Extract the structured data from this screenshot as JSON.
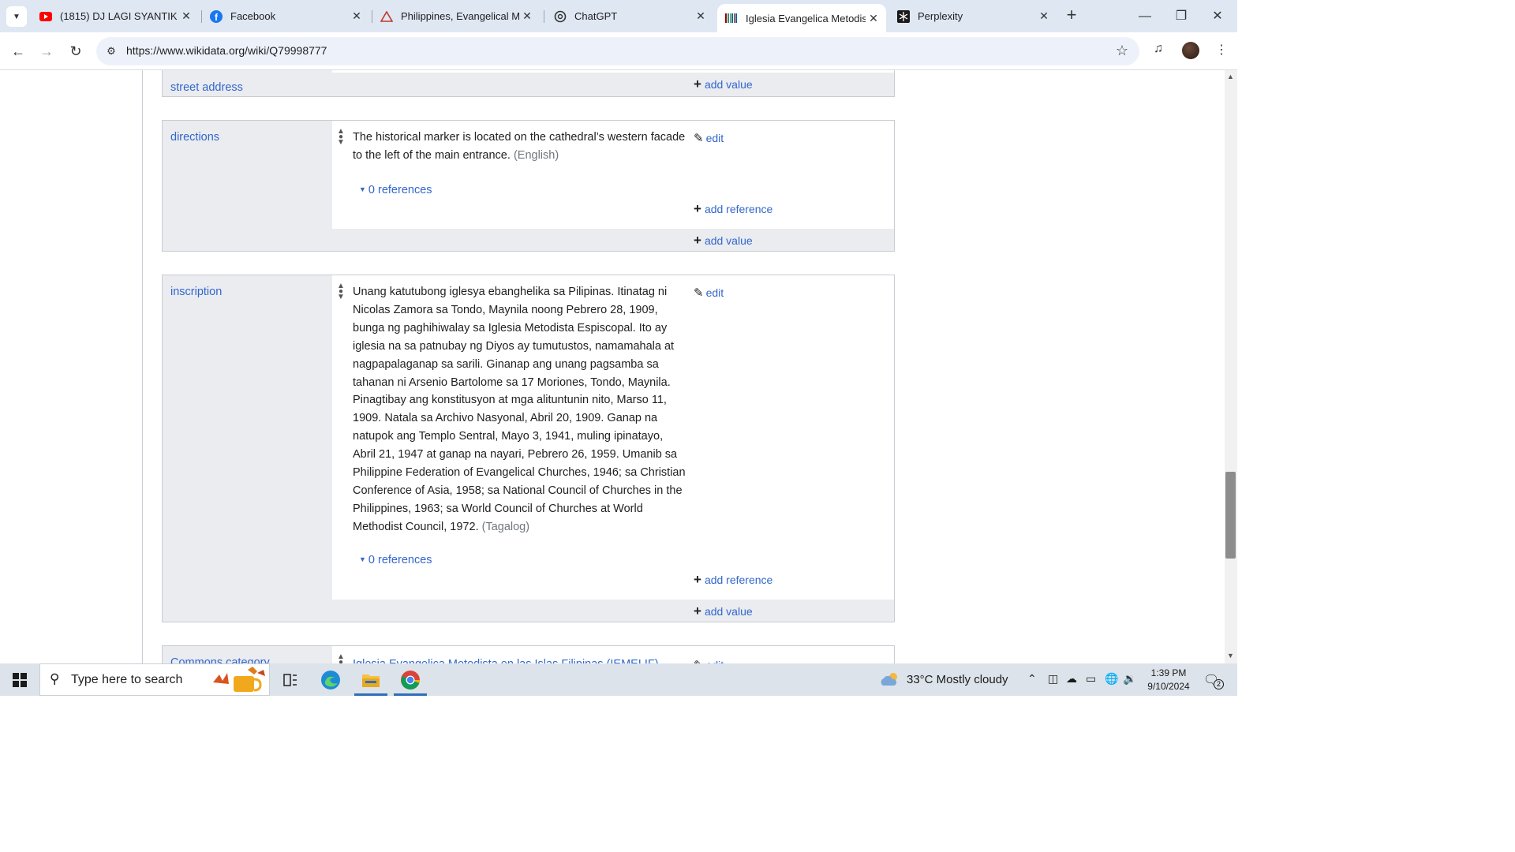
{
  "browser": {
    "tabs": [
      {
        "title": "(1815) DJ LAGI SYANTIK X",
        "icon": "youtube-icon",
        "active": false
      },
      {
        "title": "Facebook",
        "icon": "facebook-icon",
        "active": false
      },
      {
        "title": "Philippines, Evangelical Me",
        "icon": "triangle-icon",
        "active": false
      },
      {
        "title": "ChatGPT",
        "icon": "chatgpt-icon",
        "active": false
      },
      {
        "title": "Iglesia Evangelica Metodist",
        "icon": "wikidata-icon",
        "active": true
      },
      {
        "title": "Perplexity",
        "icon": "perplexity-icon",
        "active": false
      }
    ],
    "url": "https://www.wikidata.org/wiki/Q79998777"
  },
  "statements": {
    "street_address": {
      "label": "street address",
      "add_value": "add value"
    },
    "directions": {
      "label": "directions",
      "text": "The historical marker is located on the cathedral’s western facade to the left of the main entrance.",
      "language": "(English)",
      "edit": "edit",
      "references": "0 references",
      "add_reference": "add reference",
      "add_value": "add value"
    },
    "inscription": {
      "label": "inscription",
      "text": "Unang katutubong iglesya ebanghelika sa Pilipinas. Itinatag ni Nicolas Zamora sa Tondo, Maynila noong Pebrero 28, 1909, bunga ng paghihiwalay sa Iglesia Metodista Espiscopal. Ito ay iglesia na sa patnubay ng Diyos ay tumutustos, namamahala at nagpapalaganap sa sarili. Ginanap ang unang pagsamba sa tahanan ni Arsenio Bartolome sa 17 Moriones, Tondo, Maynila. Pinagtibay ang konstitusyon at mga alituntunin nito, Marso 11, 1909. Natala sa Archivo Nasyonal, Abril 20, 1909. Ganap na natupok ang Templo Sentral, Mayo 3, 1941, muling ipinatayo, Abril 21, 1947 at ganap na nayari, Pebrero 26, 1959. Umanib sa Philippine Federation of Evangelical Churches, 1946; sa Christian Conference of Asia, 1958; sa National Council of Churches in the Philippines, 1963; sa World Council of Churches at World Methodist Council, 1972.",
      "language": "(Tagalog)",
      "edit": "edit",
      "references": "0 references",
      "add_reference": "add reference",
      "add_value": "add value"
    },
    "commons_category": {
      "label": "Commons category",
      "text": "Iglesia Evangelica Metodista en las Islas Filipinas (IEMELIF)",
      "edit": "edit"
    }
  },
  "taskbar": {
    "search_placeholder": "Type here to search",
    "weather": "33°C  Mostly cloudy",
    "time": "1:39 PM",
    "date": "9/10/2024",
    "notification_count": "2"
  },
  "colors": {
    "link": "#3366cc",
    "tabstrip": "#dfe7f3",
    "statement_bg": "#eaecf0"
  }
}
